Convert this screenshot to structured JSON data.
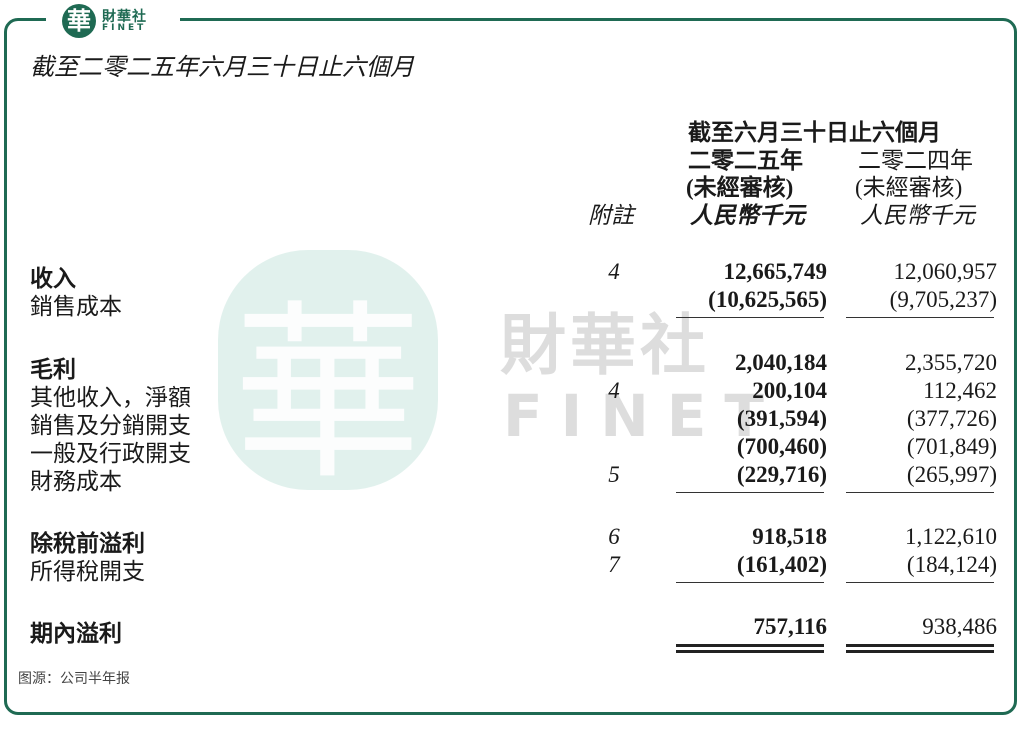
{
  "brand": {
    "seal_char": "華",
    "name_cn": "財華社",
    "name_en": "FINET"
  },
  "watermark": {
    "seal_char": "華",
    "name_cn": "財華社",
    "name_en": "FINET"
  },
  "title": "截至二零二五年六月三十日止六個月",
  "header": {
    "period": "截至六月三十日止六個月",
    "note_col": "附註",
    "col_2025": {
      "year": "二零二五年",
      "audit": "(未經審核)",
      "unit": "人民幣千元"
    },
    "col_2024": {
      "year": "二零二四年",
      "audit": "(未經審核)",
      "unit": "人民幣千元"
    }
  },
  "rows": [
    {
      "label": "收入",
      "note": "4",
      "v2025": "12,665,749",
      "v2024": "12,060,957"
    },
    {
      "label": "銷售成本",
      "note": "",
      "v2025": "(10,625,565)",
      "v2024": "(9,705,237)"
    },
    {
      "label": "毛利",
      "note": "",
      "v2025": "2,040,184",
      "v2024": "2,355,720"
    },
    {
      "label": "其他收入，淨額",
      "note": "4",
      "v2025": "200,104",
      "v2024": "112,462"
    },
    {
      "label": "銷售及分銷開支",
      "note": "",
      "v2025": "(391,594)",
      "v2024": "(377,726)"
    },
    {
      "label": "一般及行政開支",
      "note": "",
      "v2025": "(700,460)",
      "v2024": "(701,849)"
    },
    {
      "label": "財務成本",
      "note": "5",
      "v2025": "(229,716)",
      "v2024": "(265,997)"
    },
    {
      "label": "除稅前溢利",
      "note": "6",
      "v2025": "918,518",
      "v2024": "1,122,610"
    },
    {
      "label": "所得稅開支",
      "note": "7",
      "v2025": "(161,402)",
      "v2024": "(184,124)"
    },
    {
      "label": "期內溢利",
      "note": "",
      "v2025": "757,116",
      "v2024": "938,486"
    }
  ],
  "source": "图源：公司半年报",
  "colors": {
    "brand_green": "#1f6a53"
  }
}
